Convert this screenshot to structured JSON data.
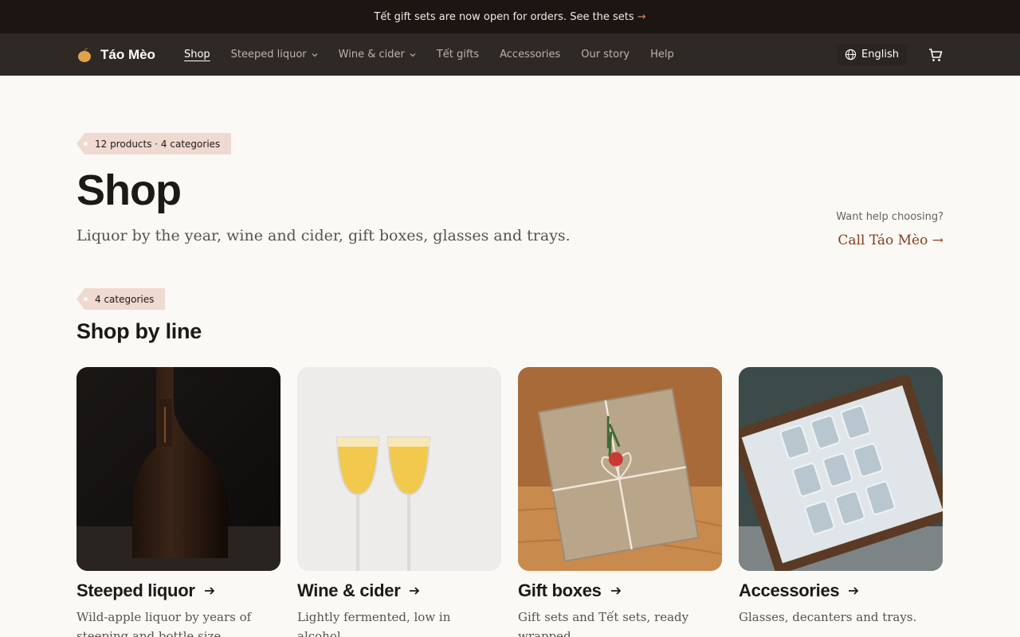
{
  "announcement": {
    "text": "Tết gift sets are now open for orders. See the sets",
    "arrow": "→"
  },
  "brand": {
    "name": "Táo Mèo"
  },
  "nav": {
    "items": [
      {
        "label": "Shop",
        "active": true
      },
      {
        "label": "Steeped liquor",
        "dropdown": true
      },
      {
        "label": "Wine & cider",
        "dropdown": true
      },
      {
        "label": "Tết gifts"
      },
      {
        "label": "Accessories"
      },
      {
        "label": "Our story"
      },
      {
        "label": "Help"
      }
    ],
    "language": "English"
  },
  "hero": {
    "tag": "12 products · 4 categories",
    "title": "Shop",
    "lead": "Liquor by the year, wine and cider, gift boxes, glasses and trays.",
    "help_question": "Want help choosing?",
    "help_cta": "Call Táo Mèo →"
  },
  "section": {
    "tag": "4 categories",
    "title": "Shop by line"
  },
  "cards": [
    {
      "title": "Steeped liquor",
      "desc": "Wild-apple liquor by years of steeping and bottle size."
    },
    {
      "title": "Wine & cider",
      "desc": "Lightly fermented, low in alcohol."
    },
    {
      "title": "Gift boxes",
      "desc": "Gift sets and Tết sets, ready wrapped."
    },
    {
      "title": "Accessories",
      "desc": "Glasses, decanters and trays."
    }
  ],
  "colors": {
    "accent": "#8a3b1b",
    "tag_bg": "#f0d9d1",
    "nav_bg": "#2e2925",
    "announce_bg": "#1c1512"
  }
}
